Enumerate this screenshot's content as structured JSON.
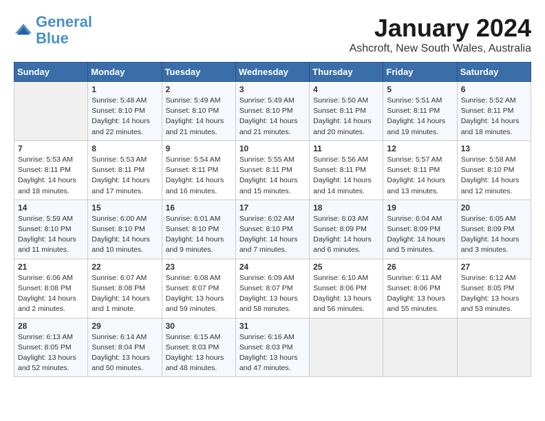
{
  "logo": {
    "line1": "General",
    "line2": "Blue"
  },
  "title": "January 2024",
  "location": "Ashcroft, New South Wales, Australia",
  "days_header": [
    "Sunday",
    "Monday",
    "Tuesday",
    "Wednesday",
    "Thursday",
    "Friday",
    "Saturday"
  ],
  "weeks": [
    [
      {
        "day": "",
        "content": ""
      },
      {
        "day": "1",
        "content": "Sunrise: 5:48 AM\nSunset: 8:10 PM\nDaylight: 14 hours\nand 22 minutes."
      },
      {
        "day": "2",
        "content": "Sunrise: 5:49 AM\nSunset: 8:10 PM\nDaylight: 14 hours\nand 21 minutes."
      },
      {
        "day": "3",
        "content": "Sunrise: 5:49 AM\nSunset: 8:10 PM\nDaylight: 14 hours\nand 21 minutes."
      },
      {
        "day": "4",
        "content": "Sunrise: 5:50 AM\nSunset: 8:11 PM\nDaylight: 14 hours\nand 20 minutes."
      },
      {
        "day": "5",
        "content": "Sunrise: 5:51 AM\nSunset: 8:11 PM\nDaylight: 14 hours\nand 19 minutes."
      },
      {
        "day": "6",
        "content": "Sunrise: 5:52 AM\nSunset: 8:11 PM\nDaylight: 14 hours\nand 18 minutes."
      }
    ],
    [
      {
        "day": "7",
        "content": "Sunrise: 5:53 AM\nSunset: 8:11 PM\nDaylight: 14 hours\nand 18 minutes."
      },
      {
        "day": "8",
        "content": "Sunrise: 5:53 AM\nSunset: 8:11 PM\nDaylight: 14 hours\nand 17 minutes."
      },
      {
        "day": "9",
        "content": "Sunrise: 5:54 AM\nSunset: 8:11 PM\nDaylight: 14 hours\nand 16 minutes."
      },
      {
        "day": "10",
        "content": "Sunrise: 5:55 AM\nSunset: 8:11 PM\nDaylight: 14 hours\nand 15 minutes."
      },
      {
        "day": "11",
        "content": "Sunrise: 5:56 AM\nSunset: 8:11 PM\nDaylight: 14 hours\nand 14 minutes."
      },
      {
        "day": "12",
        "content": "Sunrise: 5:57 AM\nSunset: 8:11 PM\nDaylight: 14 hours\nand 13 minutes."
      },
      {
        "day": "13",
        "content": "Sunrise: 5:58 AM\nSunset: 8:10 PM\nDaylight: 14 hours\nand 12 minutes."
      }
    ],
    [
      {
        "day": "14",
        "content": "Sunrise: 5:59 AM\nSunset: 8:10 PM\nDaylight: 14 hours\nand 11 minutes."
      },
      {
        "day": "15",
        "content": "Sunrise: 6:00 AM\nSunset: 8:10 PM\nDaylight: 14 hours\nand 10 minutes."
      },
      {
        "day": "16",
        "content": "Sunrise: 6:01 AM\nSunset: 8:10 PM\nDaylight: 14 hours\nand 9 minutes."
      },
      {
        "day": "17",
        "content": "Sunrise: 6:02 AM\nSunset: 8:10 PM\nDaylight: 14 hours\nand 7 minutes."
      },
      {
        "day": "18",
        "content": "Sunrise: 6:03 AM\nSunset: 8:09 PM\nDaylight: 14 hours\nand 6 minutes."
      },
      {
        "day": "19",
        "content": "Sunrise: 6:04 AM\nSunset: 8:09 PM\nDaylight: 14 hours\nand 5 minutes."
      },
      {
        "day": "20",
        "content": "Sunrise: 6:05 AM\nSunset: 8:09 PM\nDaylight: 14 hours\nand 3 minutes."
      }
    ],
    [
      {
        "day": "21",
        "content": "Sunrise: 6:06 AM\nSunset: 8:08 PM\nDaylight: 14 hours\nand 2 minutes."
      },
      {
        "day": "22",
        "content": "Sunrise: 6:07 AM\nSunset: 8:08 PM\nDaylight: 14 hours\nand 1 minute."
      },
      {
        "day": "23",
        "content": "Sunrise: 6:08 AM\nSunset: 8:07 PM\nDaylight: 13 hours\nand 59 minutes."
      },
      {
        "day": "24",
        "content": "Sunrise: 6:09 AM\nSunset: 8:07 PM\nDaylight: 13 hours\nand 58 minutes."
      },
      {
        "day": "25",
        "content": "Sunrise: 6:10 AM\nSunset: 8:06 PM\nDaylight: 13 hours\nand 56 minutes."
      },
      {
        "day": "26",
        "content": "Sunrise: 6:11 AM\nSunset: 8:06 PM\nDaylight: 13 hours\nand 55 minutes."
      },
      {
        "day": "27",
        "content": "Sunrise: 6:12 AM\nSunset: 8:05 PM\nDaylight: 13 hours\nand 53 minutes."
      }
    ],
    [
      {
        "day": "28",
        "content": "Sunrise: 6:13 AM\nSunset: 8:05 PM\nDaylight: 13 hours\nand 52 minutes."
      },
      {
        "day": "29",
        "content": "Sunrise: 6:14 AM\nSunset: 8:04 PM\nDaylight: 13 hours\nand 50 minutes."
      },
      {
        "day": "30",
        "content": "Sunrise: 6:15 AM\nSunset: 8:03 PM\nDaylight: 13 hours\nand 48 minutes."
      },
      {
        "day": "31",
        "content": "Sunrise: 6:16 AM\nSunset: 8:03 PM\nDaylight: 13 hours\nand 47 minutes."
      },
      {
        "day": "",
        "content": ""
      },
      {
        "day": "",
        "content": ""
      },
      {
        "day": "",
        "content": ""
      }
    ]
  ]
}
